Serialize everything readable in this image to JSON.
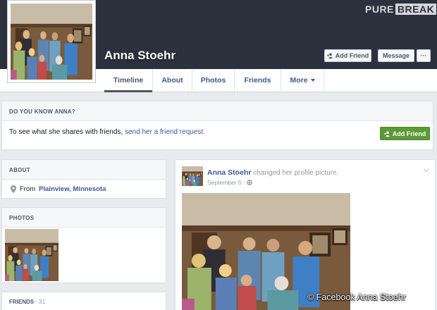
{
  "watermark": {
    "part1": "PURE",
    "part2": "BREAK"
  },
  "profile": {
    "name": "Anna Stoehr"
  },
  "header_buttons": {
    "add_friend": "Add Friend",
    "message": "Message",
    "more": "···"
  },
  "nav": {
    "tabs": [
      {
        "label": "Timeline"
      },
      {
        "label": "About"
      },
      {
        "label": "Photos"
      },
      {
        "label": "Friends"
      },
      {
        "label": "More"
      }
    ]
  },
  "know": {
    "heading": "DO YOU KNOW ANNA?",
    "text": "To see what she shares with friends,",
    "link": "send her a friend request.",
    "button": "Add Friend"
  },
  "about": {
    "heading": "ABOUT",
    "from_prefix": "From",
    "place": "Plainview, Minnesota"
  },
  "photos": {
    "heading": "PHOTOS"
  },
  "friends": {
    "heading": "FRIENDS",
    "count": "· 31"
  },
  "post": {
    "author": "Anna Stoehr",
    "action": "changed her profile picture.",
    "date": "September 5 ·"
  },
  "credit": "© Facebook Anna Stoehr",
  "colors": {
    "cover": "#2b313d",
    "link": "#3b5998",
    "green_button": "#5b9a37",
    "page_bg": "#e9eaed"
  }
}
